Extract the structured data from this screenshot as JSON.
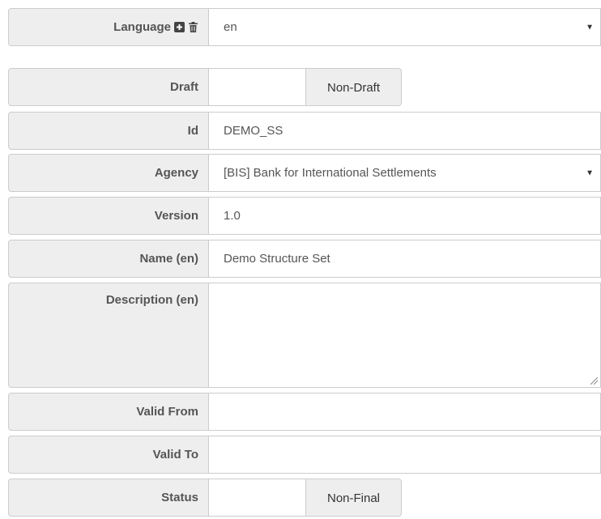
{
  "fields": {
    "language": {
      "label": "Language",
      "value": "en"
    },
    "draft": {
      "label": "Draft",
      "option": "Non-Draft"
    },
    "id": {
      "label": "Id",
      "value": "DEMO_SS"
    },
    "agency": {
      "label": "Agency",
      "value": "[BIS] Bank for International Settlements"
    },
    "version": {
      "label": "Version",
      "value": "1.0"
    },
    "name": {
      "label": "Name (en)",
      "value": "Demo Structure Set"
    },
    "description": {
      "label": "Description (en)",
      "value": ""
    },
    "valid_from": {
      "label": "Valid From",
      "value": ""
    },
    "valid_to": {
      "label": "Valid To",
      "value": ""
    },
    "status": {
      "label": "Status",
      "option": "Non-Final"
    }
  },
  "icons": {
    "add": "plus-square-icon",
    "delete": "trash-icon",
    "dropdown": "caret-down-icon"
  }
}
